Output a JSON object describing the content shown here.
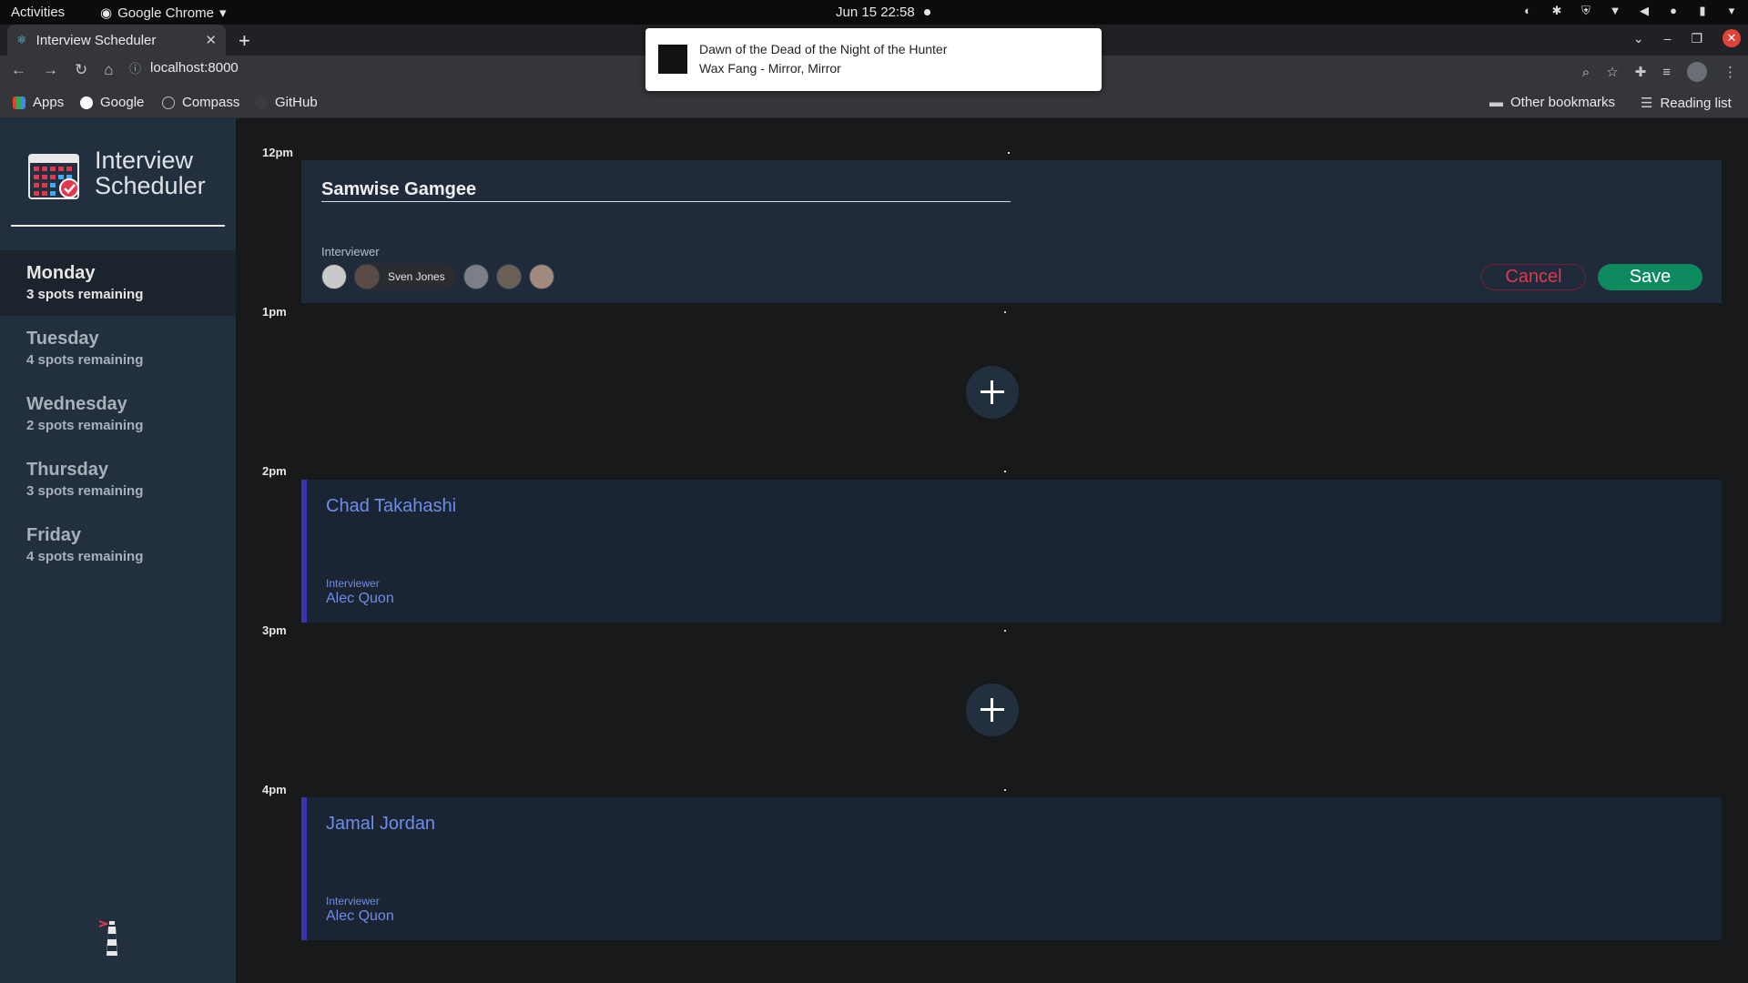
{
  "system": {
    "activities": "Activities",
    "app_menu": "Google Chrome",
    "clock": "Jun 15  22:58"
  },
  "browser": {
    "tab_title": "Interview Scheduler",
    "url": "localhost:8000",
    "bookmarks": [
      "Apps",
      "Google",
      "Compass",
      "GitHub"
    ],
    "other_bookmarks": "Other bookmarks",
    "reading_list": "Reading list"
  },
  "notification": {
    "title": "Dawn of the Dead of the Night of the Hunter",
    "subtitle": "Wax Fang - Mirror, Mirror"
  },
  "app": {
    "logo_line1": "Interview",
    "logo_line2": "Scheduler",
    "days": [
      {
        "name": "Monday",
        "spots": "3 spots remaining",
        "selected": true
      },
      {
        "name": "Tuesday",
        "spots": "4 spots remaining",
        "selected": false
      },
      {
        "name": "Wednesday",
        "spots": "2 spots remaining",
        "selected": false
      },
      {
        "name": "Thursday",
        "spots": "3 spots remaining",
        "selected": false
      },
      {
        "name": "Friday",
        "spots": "4 spots remaining",
        "selected": false
      }
    ],
    "times": [
      "12pm",
      "1pm",
      "2pm",
      "3pm",
      "4pm"
    ],
    "form": {
      "student_value": "Samwise Gamgee",
      "interviewer_label": "Interviewer",
      "selected_interviewer": "Sven Jones",
      "cancel_label": "Cancel",
      "save_label": "Save"
    },
    "appointments": [
      {
        "student": "Chad Takahashi",
        "label": "Interviewer",
        "interviewer": "Alec Quon"
      },
      {
        "student": "Jamal Jordan",
        "label": "Interviewer",
        "interviewer": "Alec Quon"
      }
    ]
  },
  "colors": {
    "sidebar": "#222f3e",
    "card": "#1a2433",
    "accent_text": "#6d8ee8",
    "save": "#0e8a5f",
    "cancel": "#e0384f"
  }
}
